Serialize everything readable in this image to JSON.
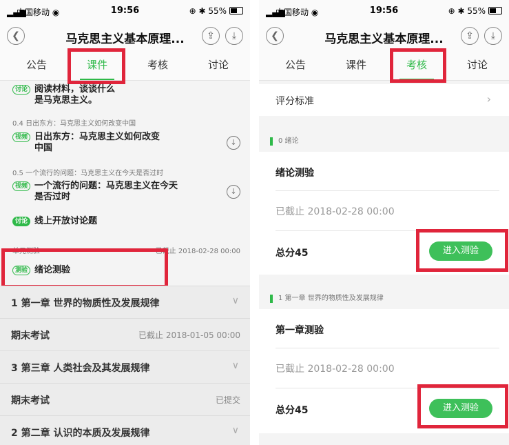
{
  "status": {
    "carrier": "中国移动",
    "time": "19:56",
    "battery": "55%"
  },
  "title": "马克思主义基本原理...",
  "tabs": [
    "公告",
    "课件",
    "考核",
    "讨论"
  ],
  "left": {
    "item0_tag": "讨论",
    "item0_title": "阅读材料，谈谈什么是马克思主义。",
    "sub1": "0.4 日出东方：马克思主义如何改变中国",
    "item1_tag": "视频",
    "item1_title": "日出东方：马克思主义如何改变中国",
    "sub2": "0.5 一个流行的问题：马克思主义在今天是否过时",
    "item2_tag": "视频",
    "item2_title": "一个流行的问题：马克思主义在今天是否过时",
    "item3_tag": "讨论",
    "item3_title": "线上开放讨论题",
    "sub3_left": "单元测验",
    "sub3_right": "已截止 2018-02-28 00:00",
    "item4_tag": "测验",
    "item4_title": "绪论测验",
    "sections": [
      {
        "label": "1 第一章 世界的物质性及发展规律",
        "meta": ""
      },
      {
        "label": "期末考试",
        "meta": "已截止 2018-01-05 00:00"
      },
      {
        "label": "3 第三章 人类社会及其发展规律",
        "meta": ""
      },
      {
        "label": "期末考试",
        "meta": "已提交"
      },
      {
        "label": "2 第二章 认识的本质及发展规律",
        "meta": ""
      }
    ]
  },
  "right": {
    "grading": "评分标准",
    "group1": "0 绪论",
    "quiz1_title": "绪论测验",
    "quiz1_deadline": "已截止 2018-02-28 00:00",
    "quiz1_score": "总分45",
    "enter_label": "进入测验",
    "group2": "1 第一章 世界的物质性及发展规律",
    "quiz2_title": "第一章测验",
    "quiz2_deadline": "已截止 2018-02-28 00:00",
    "quiz2_score": "总分45"
  },
  "colors": {
    "accent": "#2fb949",
    "highlight": "#e0253b"
  }
}
